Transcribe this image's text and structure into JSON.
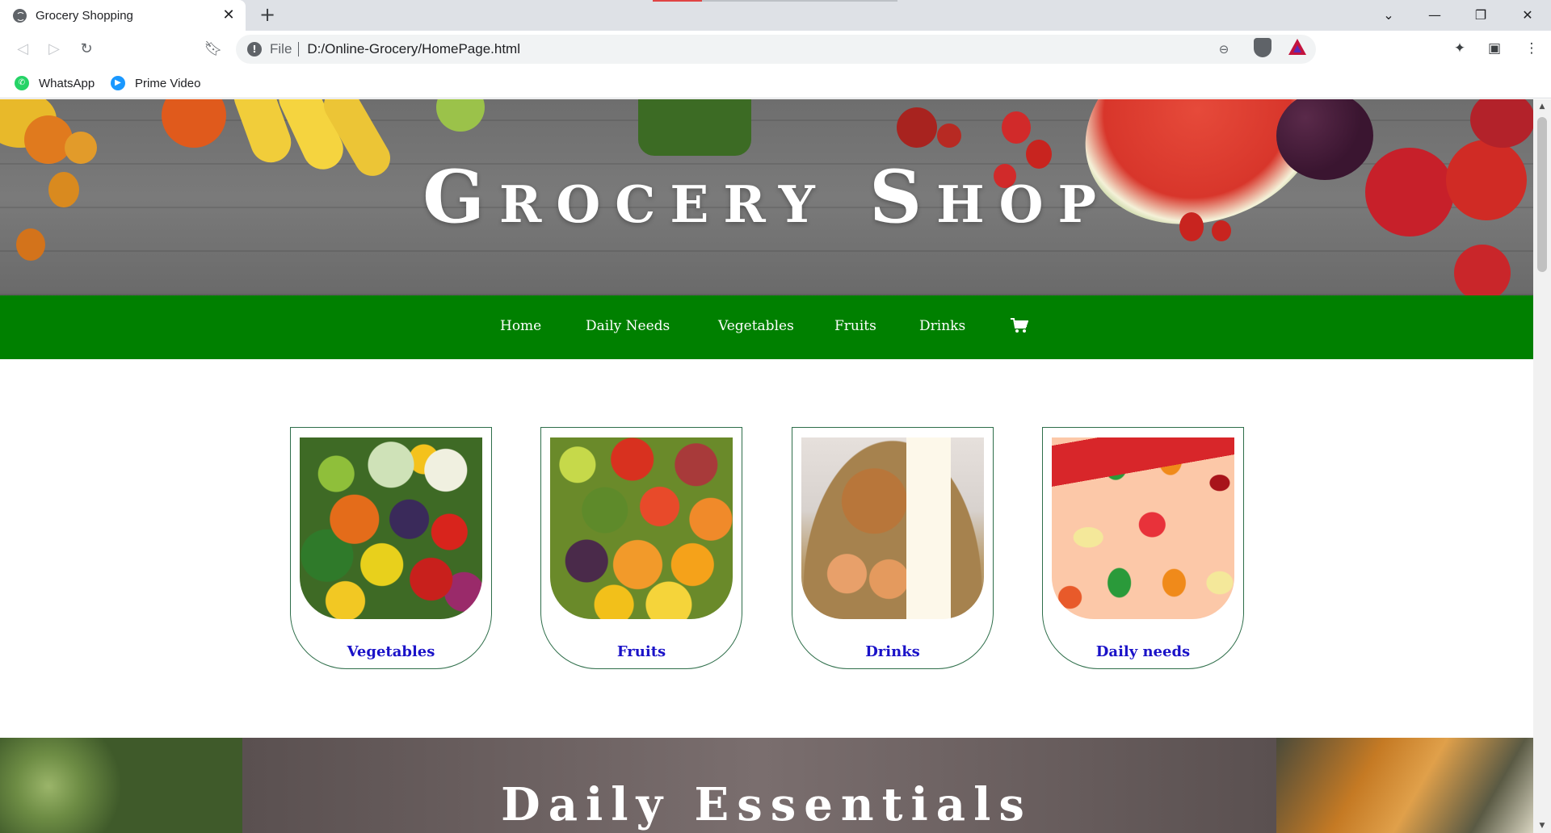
{
  "browser": {
    "tab_title": "Grocery Shopping",
    "tab_close": "✕",
    "new_tab": "+",
    "url_scheme": "File",
    "url": "D:/Online-Grocery/HomePage.html",
    "bookmarks": [
      {
        "label": "WhatsApp",
        "icon": "whatsapp-icon",
        "color": "#25d366"
      },
      {
        "label": "Prime Video",
        "icon": "prime-video-icon",
        "color": "#1a98ff"
      }
    ]
  },
  "hero": {
    "title": "Grocery Shop"
  },
  "nav": {
    "items": [
      "Home",
      "Daily Needs",
      "Vegetables",
      "Fruits",
      "Drinks"
    ],
    "cart_icon": "shopping-cart-icon",
    "background": "#008000"
  },
  "categories": [
    {
      "label": "Vegetables"
    },
    {
      "label": "Fruits"
    },
    {
      "label": "Drinks"
    },
    {
      "label": "Daily needs"
    }
  ],
  "banner": {
    "title": "Daily Essentials"
  },
  "colors": {
    "category_label": "#1a12c8",
    "card_border": "#2e6e4a"
  }
}
